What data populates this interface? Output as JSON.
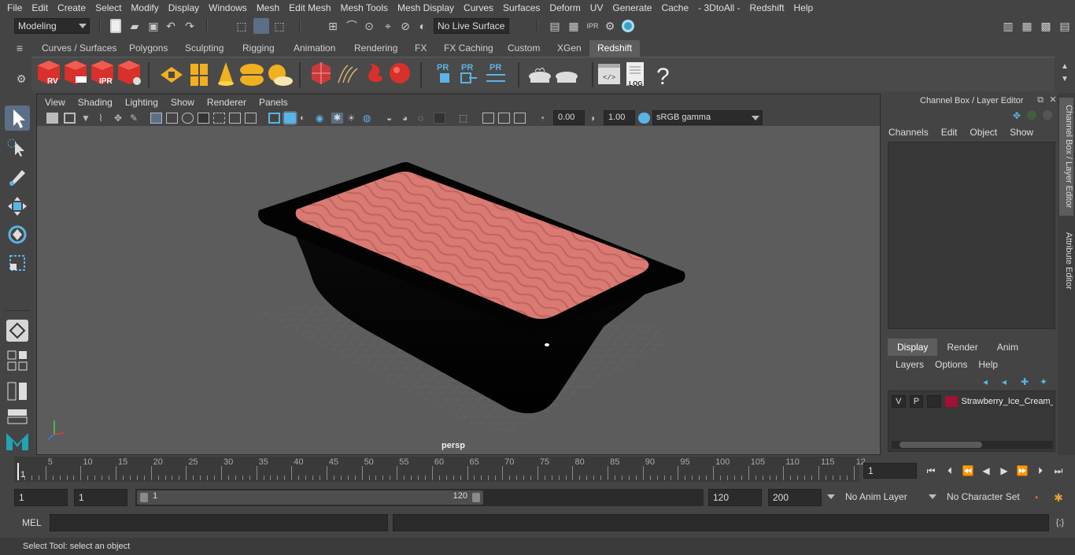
{
  "menubar": [
    "File",
    "Edit",
    "Create",
    "Select",
    "Modify",
    "Display",
    "Windows",
    "Mesh",
    "Edit Mesh",
    "Mesh Tools",
    "Mesh Display",
    "Curves",
    "Surfaces",
    "Deform",
    "UV",
    "Generate",
    "Cache",
    "- 3DtoAll -",
    "Redshift",
    "Help"
  ],
  "statusline": {
    "workspace": "Modeling",
    "live_surface": "No Live Surface"
  },
  "shelf_tabs": [
    "Curves / Surfaces",
    "Polygons",
    "Sculpting",
    "Rigging",
    "Animation",
    "Rendering",
    "FX",
    "FX Caching",
    "Custom",
    "XGen",
    "Redshift"
  ],
  "shelf_active_tab": "Redshift",
  "shelf_labels": {
    "rv": "RV",
    "ipr": "IPR",
    "pr1": "PR",
    "pr2": "PR",
    "pr3": "PR",
    "log": ".LOG",
    "help": "?"
  },
  "viewport": {
    "menu": [
      "View",
      "Shading",
      "Lighting",
      "Show",
      "Renderer",
      "Panels"
    ],
    "exposure": "0.00",
    "gamma": "1.00",
    "colorspace": "sRGB gamma",
    "camera": "persp"
  },
  "channel_box": {
    "title": "Channel Box / Layer Editor",
    "menu": [
      "Channels",
      "Edit",
      "Object",
      "Show"
    ]
  },
  "layer_editor": {
    "tabs": [
      "Display",
      "Render",
      "Anim"
    ],
    "active_tab": "Display",
    "menu": [
      "Layers",
      "Options",
      "Help"
    ],
    "layer": {
      "v": "V",
      "p": "P",
      "name": "Strawberry_Ice_Cream_",
      "color": "#a01236"
    }
  },
  "side_tabs": [
    "Channel Box / Layer Editor",
    "Attribute Editor"
  ],
  "timeline": {
    "ticks": [
      "5",
      "10",
      "15",
      "20",
      "25",
      "30",
      "35",
      "40",
      "45",
      "50",
      "55",
      "60",
      "65",
      "70",
      "75",
      "80",
      "85",
      "90",
      "95",
      "100",
      "105",
      "110",
      "115",
      "12"
    ],
    "current_frame_marker": "1",
    "current_frame_field": "1"
  },
  "range": {
    "start": "1",
    "playback_start": "1",
    "slider_start": "1",
    "slider_end": "120",
    "playback_end": "120",
    "end": "200",
    "anim_layer": "No Anim Layer",
    "character_set": "No Character Set"
  },
  "command_line": {
    "label": "MEL"
  },
  "status_text": "Select Tool: select an object",
  "colors": {
    "accent": "#5b6f86",
    "ice_cream": "#d97a73",
    "tub": "#050505"
  }
}
